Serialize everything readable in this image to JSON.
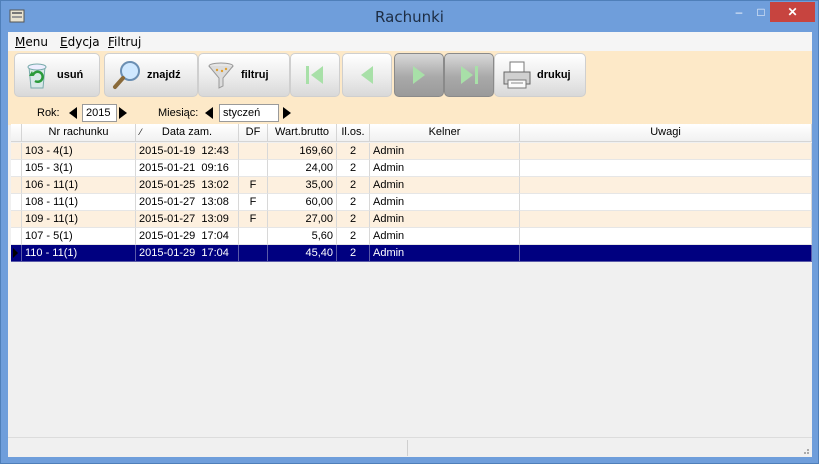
{
  "window": {
    "title": "Rachunki",
    "minimize": "‒",
    "maximize": "□",
    "close": "✕"
  },
  "menu": [
    "Menu",
    "Edycja",
    "Filtruj"
  ],
  "menu_access": [
    "M",
    "E",
    "F"
  ],
  "toolbar": {
    "delete_label": "usuń",
    "find_label": "znajdź",
    "filter_label": "filtruj",
    "print_label": "drukuj"
  },
  "selectors": {
    "year_label": "Rok:",
    "year_value": "2015",
    "month_label": "Miesiąc:",
    "month_value": "styczeń"
  },
  "table": {
    "sort_indicator": "⁄",
    "columns": [
      "Nr rachunku",
      "Data zam.",
      "DF",
      "Wart.brutto",
      "Il.os.",
      "Kelner",
      "Uwagi"
    ],
    "rows": [
      [
        "103 - 4(1)",
        "2015-01-19  12:43",
        "",
        "169,60",
        "2",
        "Admin",
        ""
      ],
      [
        "105 - 3(1)",
        "2015-01-21  09:16",
        "",
        "24,00",
        "2",
        "Admin",
        ""
      ],
      [
        "106 - 11(1)",
        "2015-01-25  13:02",
        "F",
        "35,00",
        "2",
        "Admin",
        ""
      ],
      [
        "108 - 11(1)",
        "2015-01-27  13:08",
        "F",
        "60,00",
        "2",
        "Admin",
        ""
      ],
      [
        "109 - 11(1)",
        "2015-01-27  13:09",
        "F",
        "27,00",
        "2",
        "Admin",
        ""
      ],
      [
        "107 - 5(1)",
        "2015-01-29  17:04",
        "",
        "5,60",
        "2",
        "Admin",
        ""
      ],
      [
        "110 - 11(1)",
        "2015-01-29  17:04",
        "",
        "45,40",
        "2",
        "Admin",
        ""
      ]
    ],
    "selected_row": 6
  },
  "colors": {
    "selection": "#000080",
    "toolbar_bg": "#fde9c8",
    "row_alt": "#fdf0df",
    "title_bar": "#6f9edb"
  }
}
